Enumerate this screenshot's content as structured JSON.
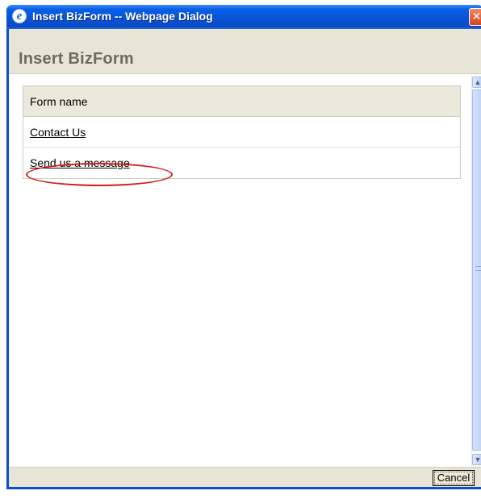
{
  "window": {
    "title": "Insert BizForm -- Webpage Dialog",
    "icon": "ie-icon",
    "close_icon": "close-icon"
  },
  "header": {
    "title": "Insert BizForm"
  },
  "grid": {
    "column_header": "Form name",
    "rows": [
      {
        "name": "Contact Us"
      },
      {
        "name": "Send us a message"
      }
    ],
    "highlighted_row": 1,
    "highlight_color": "#d41c1c"
  },
  "footer": {
    "cancel_label": "Cancel"
  },
  "colors": {
    "titlebar": "#0754d6",
    "header_bg": "#e7e6d6",
    "header_text": "#6d6b59",
    "grid_header_bg": "#ebe9dc"
  }
}
